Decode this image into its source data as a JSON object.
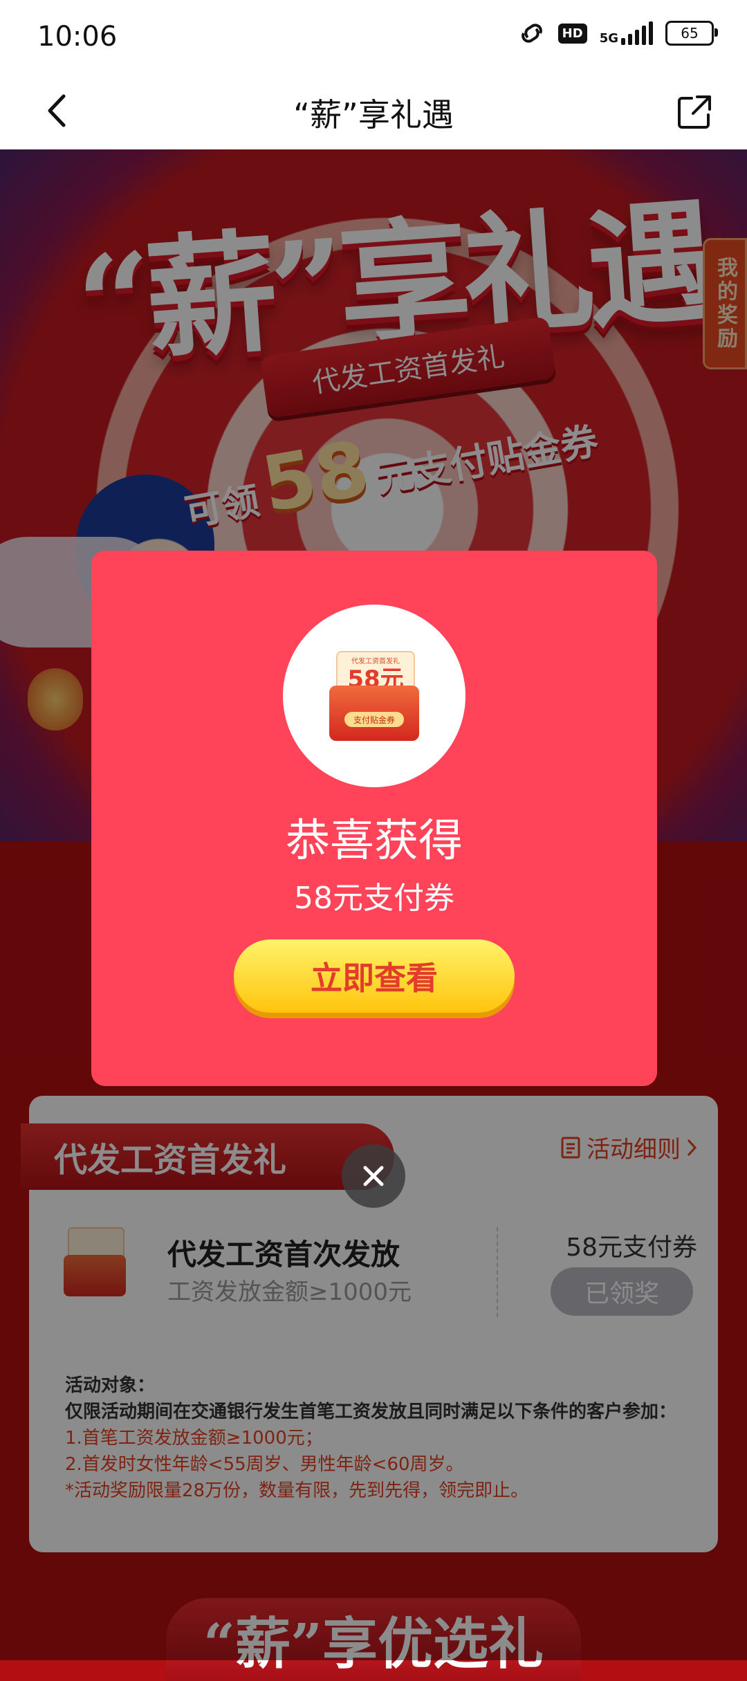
{
  "status_bar": {
    "time": "10:06",
    "hd": "HD",
    "network": "5G",
    "battery": "65"
  },
  "nav": {
    "title": "“薪”享礼遇"
  },
  "hero": {
    "title": "“薪”享礼遇",
    "ribbon": "代发工资首发礼",
    "sub_prefix": "可领",
    "sub_amount": "58",
    "sub_suffix": "元支付贴金券",
    "reward_tab": "我的奖励"
  },
  "modal": {
    "coupon_line1": "代发工资首发礼",
    "coupon_amount": "58元",
    "coupon_label": "支付贴金券",
    "title": "恭喜获得",
    "subtitle": "58元支付券",
    "button": "立即查看"
  },
  "card": {
    "header": "代发工资首发礼",
    "rules_link": "活动细则",
    "item_title": "代发工资首次发放",
    "item_desc": "工资发放金额≥1000元",
    "item_reward": "58元支付券",
    "item_button": "已领奖",
    "info_title": "活动对象：",
    "info_line1": "仅限活动期间在交通银行发生首笔工资发放且同时满足以下条件的客户参加：",
    "info_line2": "1.首笔工资发放金额≥1000元；",
    "info_line3": "2.首发时女性年龄<55周岁、男性年龄<60周岁。",
    "info_line4": "*活动奖励限量28万份，数量有限，先到先得，领完即止。"
  },
  "bottom_banner": "“薪”享优选礼",
  "colors": {
    "modal_bg": "#ff4459",
    "button_yellow": "#ffd21e",
    "accent_red": "#e33b2c"
  }
}
